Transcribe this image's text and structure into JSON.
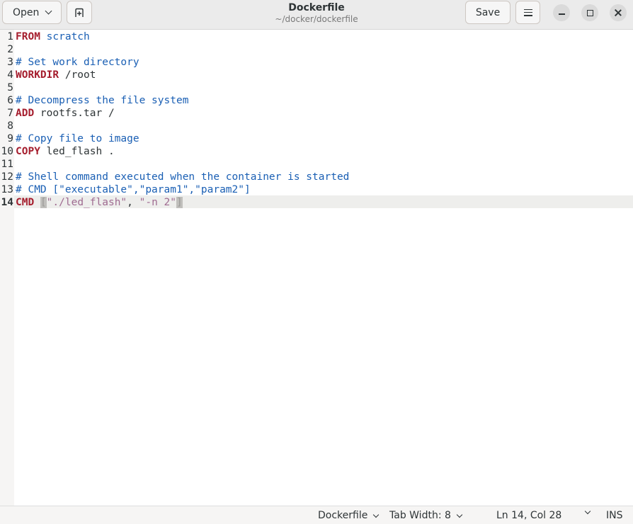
{
  "header": {
    "open_label": "Open",
    "save_label": "Save",
    "title": "Dockerfile",
    "subtitle": "~/docker/dockerfile"
  },
  "editor": {
    "current_line": 14,
    "lines": [
      {
        "n": "1",
        "tokens": [
          {
            "t": "FROM",
            "c": "kw"
          },
          {
            "t": " ",
            "c": "plain"
          },
          {
            "t": "scratch",
            "c": "img"
          }
        ]
      },
      {
        "n": "2",
        "tokens": []
      },
      {
        "n": "3",
        "tokens": [
          {
            "t": "# Set work directory",
            "c": "cm"
          }
        ]
      },
      {
        "n": "4",
        "tokens": [
          {
            "t": "WORKDIR",
            "c": "kw"
          },
          {
            "t": " /root",
            "c": "plain"
          }
        ]
      },
      {
        "n": "5",
        "tokens": []
      },
      {
        "n": "6",
        "tokens": [
          {
            "t": "# Decompress the file system",
            "c": "cm"
          }
        ]
      },
      {
        "n": "7",
        "tokens": [
          {
            "t": "ADD",
            "c": "kw"
          },
          {
            "t": " rootfs.tar /",
            "c": "plain"
          }
        ]
      },
      {
        "n": "8",
        "tokens": []
      },
      {
        "n": "9",
        "tokens": [
          {
            "t": "# Copy file to image",
            "c": "cm"
          }
        ]
      },
      {
        "n": "10",
        "tokens": [
          {
            "t": "COPY",
            "c": "kw"
          },
          {
            "t": " led_flash .",
            "c": "plain"
          }
        ]
      },
      {
        "n": "11",
        "tokens": []
      },
      {
        "n": "12",
        "tokens": [
          {
            "t": "# Shell command executed when the container is started",
            "c": "cm"
          }
        ]
      },
      {
        "n": "13",
        "tokens": [
          {
            "t": "# CMD [\"executable\",\"param1\",\"param2\"]",
            "c": "cm"
          }
        ]
      },
      {
        "n": "14",
        "tokens": [
          {
            "t": "CMD",
            "c": "kw"
          },
          {
            "t": " ",
            "c": "plain"
          },
          {
            "t": "[",
            "c": "br"
          },
          {
            "t": "\"./led_flash\"",
            "c": "str"
          },
          {
            "t": ", ",
            "c": "plain"
          },
          {
            "t": "\"-n 2\"",
            "c": "str"
          },
          {
            "t": "]",
            "c": "br"
          }
        ]
      }
    ]
  },
  "statusbar": {
    "language": "Dockerfile",
    "tab_width": "Tab Width: 8",
    "position": "Ln 14, Col 28",
    "mode": "INS"
  },
  "colors": {
    "keyword": "#a51d2d",
    "comment": "#1a5fb4",
    "string": "#9f6b91",
    "headerbar": "#ebebeb"
  }
}
